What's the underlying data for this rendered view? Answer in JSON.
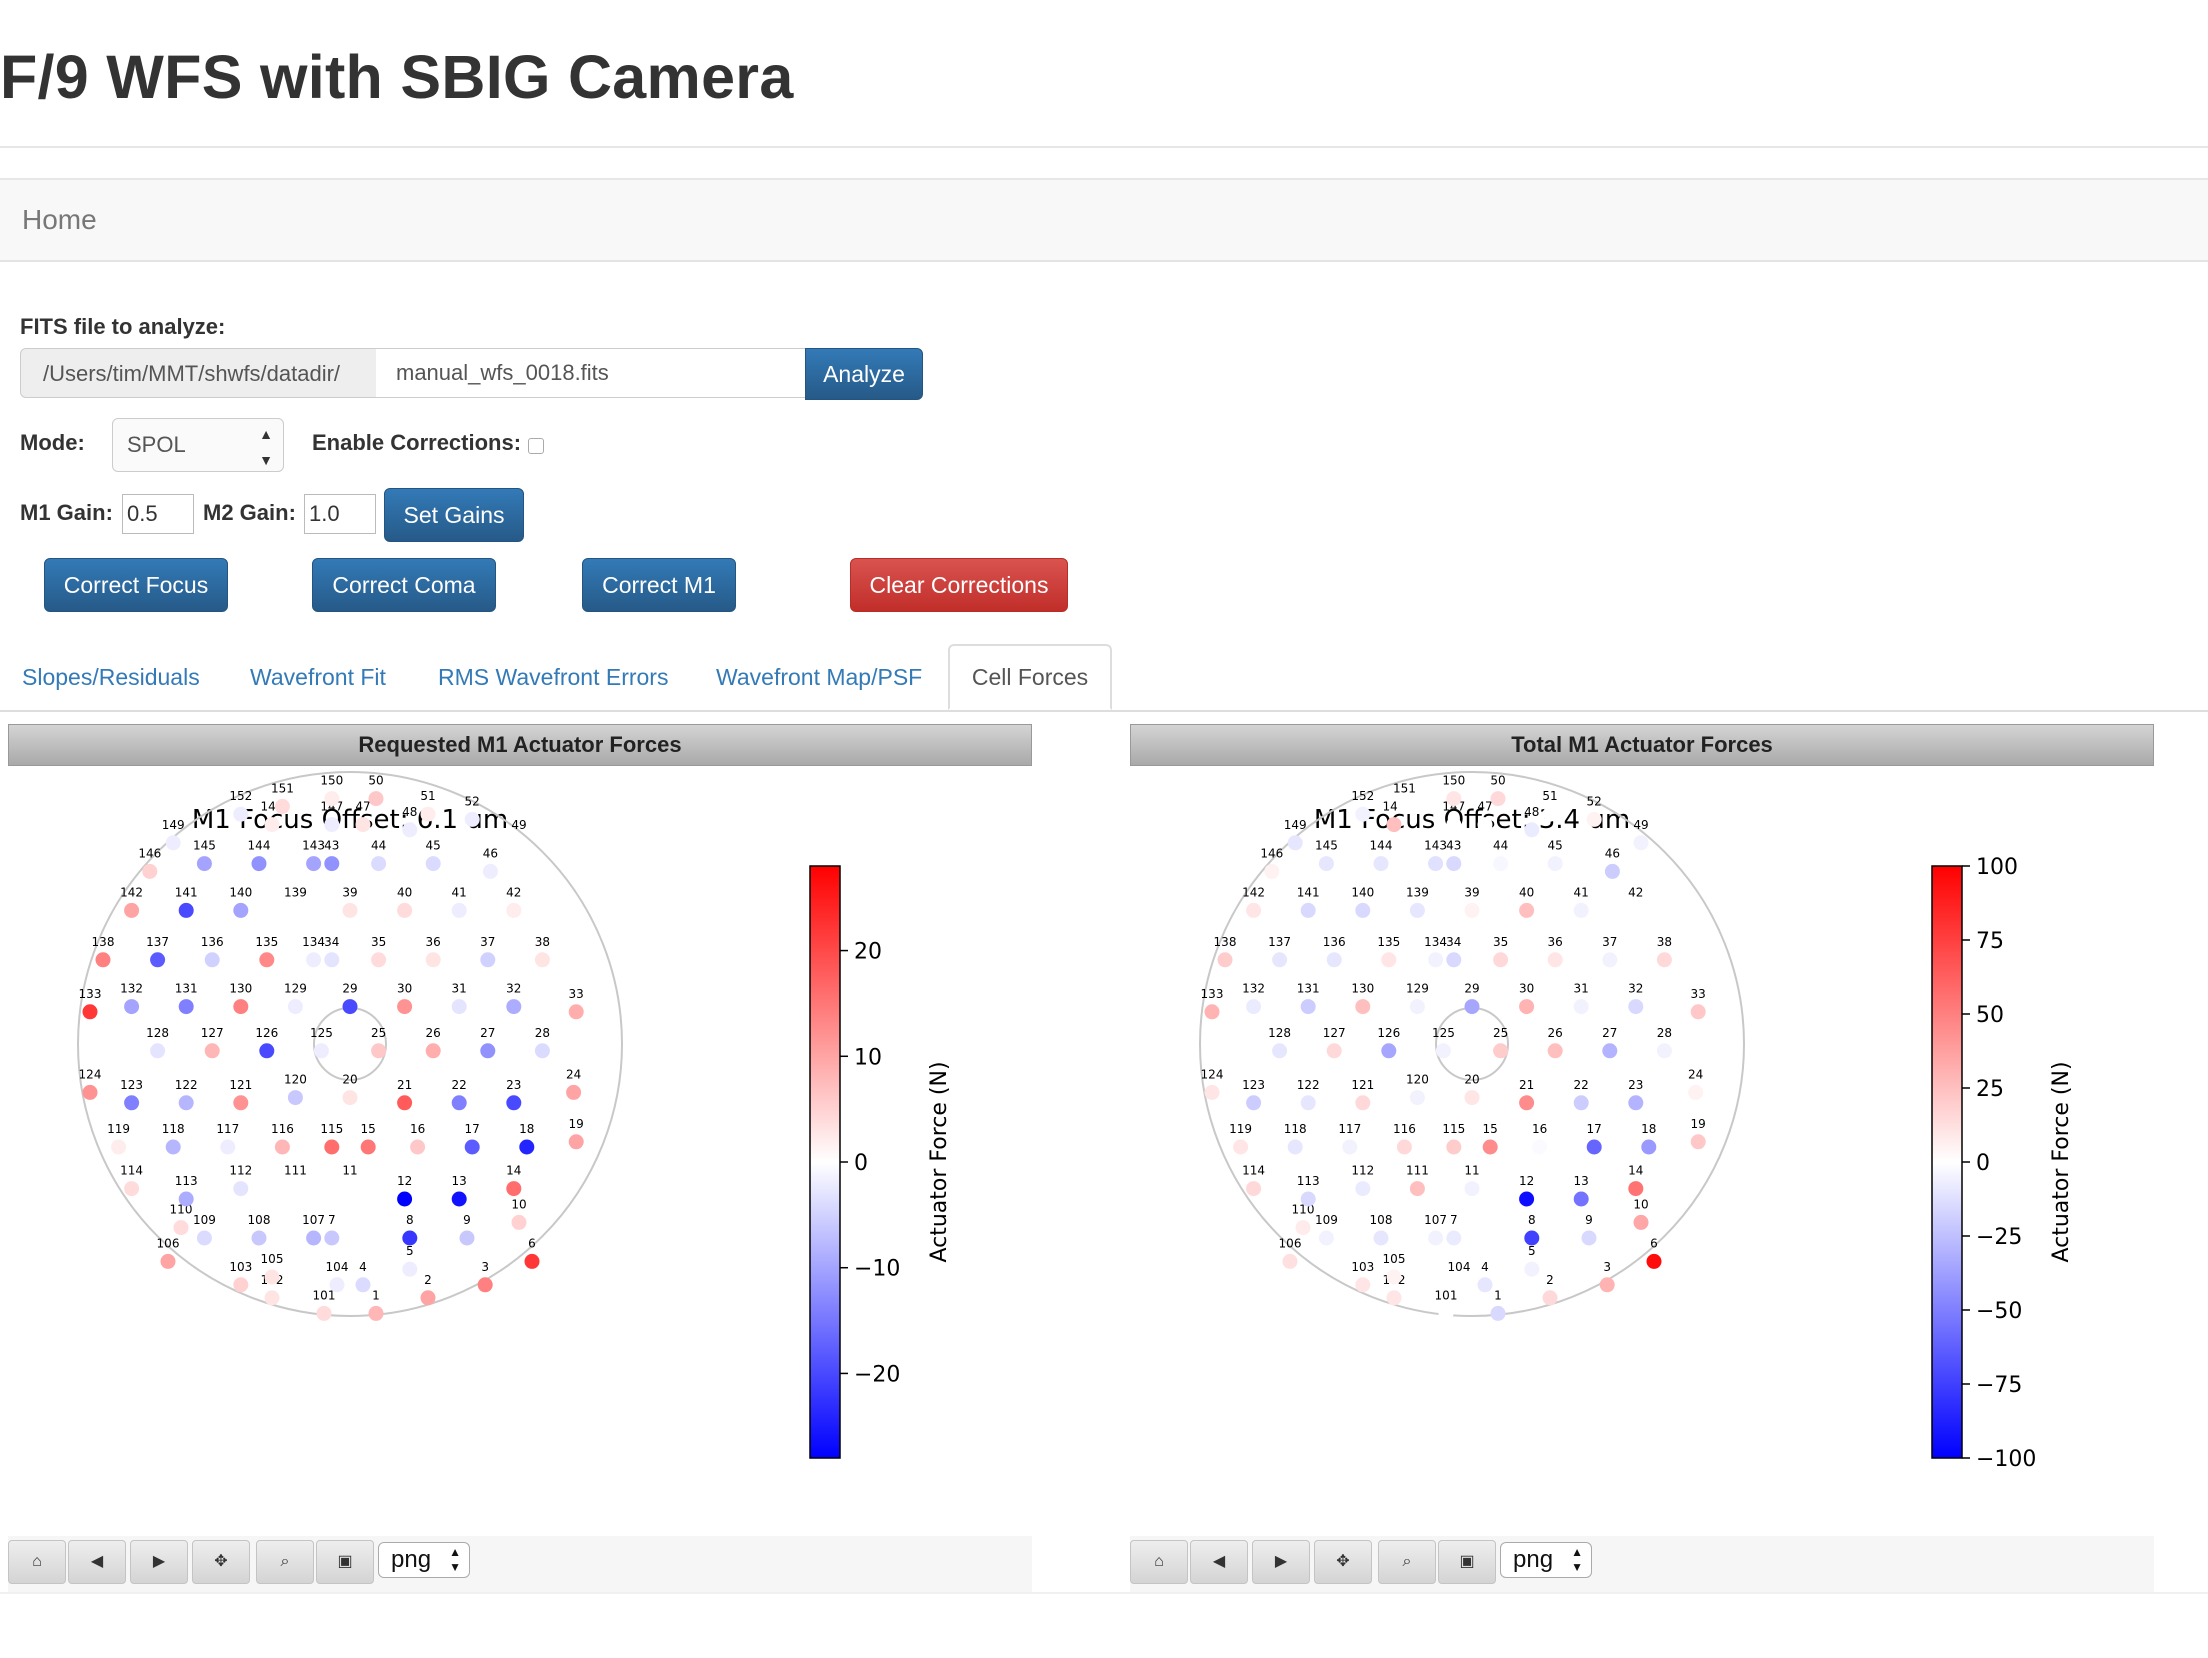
{
  "page": {
    "title": "F/9 WFS with SBIG Camera",
    "nav_home": "Home"
  },
  "form": {
    "fits_label": "FITS file to analyze:",
    "dir_prefix": "/Users/tim/MMT/shwfs/datadir/",
    "file_value": "manual_wfs_0018.fits",
    "analyze_label": "Analyze",
    "mode_label": "Mode:",
    "mode_value": "SPOL",
    "enable_corrections_label": "Enable Corrections:",
    "enable_corrections_checked": false,
    "m1_gain_label": "M1 Gain:",
    "m1_gain_value": "0.5",
    "m2_gain_label": "M2 Gain:",
    "m2_gain_value": "1.0",
    "set_gains_label": "Set Gains",
    "correct_focus_label": "Correct Focus",
    "correct_coma_label": "Correct Coma",
    "correct_m1_label": "Correct M1",
    "clear_corrections_label": "Clear Corrections"
  },
  "tabs": [
    {
      "label": "Slopes/Residuals"
    },
    {
      "label": "Wavefront Fit"
    },
    {
      "label": "RMS Wavefront Errors"
    },
    {
      "label": "Wavefront Map/PSF"
    },
    {
      "label": "Cell Forces",
      "active": true
    }
  ],
  "colors": {
    "primary_button": "#337ab7",
    "danger_button": "#d9534f",
    "link": "#337ab7",
    "colormap_low": "#0000ff",
    "colormap_mid": "#ffffff",
    "colormap_high": "#ff0000"
  },
  "toolbar": {
    "format_value": "png",
    "icons": [
      "home-icon",
      "back-icon",
      "forward-icon",
      "pan-icon",
      "zoom-icon",
      "save-icon"
    ]
  },
  "panels": [
    {
      "header": "Requested M1 Actuator Forces",
      "plot_title": "M1 Focus Offset: 6.1 um",
      "colorbar_label": "Actuator Force (N)",
      "colorbar_ticks": [
        "20",
        "10",
        "0",
        "−10",
        "−20"
      ]
    },
    {
      "header": "Total M1 Actuator Forces",
      "plot_title": "M1 Focus Offset: 3.4 um",
      "colorbar_label": "Actuator Force (N)",
      "colorbar_ticks": [
        "100",
        "75",
        "50",
        "25",
        "0",
        "−25",
        "−50",
        "−75",
        "−100"
      ]
    }
  ],
  "chart_data": [
    {
      "type": "scatter",
      "title": "M1 Focus Offset: 6.1 um",
      "colorbar_label": "Actuator Force (N)",
      "colorbar_range": [
        -28,
        28
      ],
      "actuator_labels": [
        "1",
        "2",
        "3",
        "4",
        "5",
        "6",
        "7",
        "8",
        "9",
        "10",
        "11",
        "12",
        "13",
        "14",
        "15",
        "16",
        "17",
        "18",
        "19",
        "20",
        "21",
        "22",
        "23",
        "24",
        "25",
        "26",
        "27",
        "28",
        "29",
        "30",
        "31",
        "32",
        "33",
        "34",
        "35",
        "36",
        "37",
        "38",
        "39",
        "40",
        "41",
        "42",
        "43",
        "44",
        "45",
        "46",
        "47",
        "48",
        "49",
        "50",
        "51",
        "52",
        "101",
        "102",
        "103",
        "104",
        "105",
        "106",
        "107",
        "108",
        "109",
        "110",
        "111",
        "112",
        "113",
        "114",
        "115",
        "116",
        "117",
        "118",
        "119",
        "120",
        "121",
        "122",
        "123",
        "124",
        "125",
        "126",
        "127",
        "128",
        "129",
        "130",
        "131",
        "132",
        "133",
        "134",
        "135",
        "136",
        "137",
        "138",
        "139",
        "140",
        "141",
        "142",
        "143",
        "144",
        "145",
        "146",
        "147",
        "148",
        "149",
        "150",
        "151",
        "152"
      ],
      "forces": [
        8,
        10,
        14,
        -4,
        -2,
        22,
        -6,
        -22,
        -6,
        5,
        0,
        -28,
        -26,
        16,
        15,
        6,
        -18,
        -24,
        10,
        3,
        18,
        -14,
        -20,
        10,
        6,
        9,
        -12,
        -4,
        -20,
        12,
        -3,
        -9,
        9,
        -3,
        4,
        3,
        -5,
        3,
        3,
        4,
        -2,
        2,
        -12,
        -4,
        -4,
        -2,
        3,
        -2,
        0,
        6,
        2,
        -2,
        4,
        3,
        5,
        -2,
        3,
        10,
        -8,
        -6,
        -4,
        4,
        0,
        -3,
        -9,
        4,
        16,
        8,
        -2,
        -8,
        2,
        -6,
        12,
        -8,
        -14,
        12,
        -2,
        -20,
        8,
        -3,
        -2,
        14,
        -14,
        -10,
        22,
        -2,
        13,
        -5,
        -18,
        14,
        0,
        -10,
        -20,
        10,
        -10,
        -12,
        -10,
        5,
        -2,
        2,
        -2,
        2,
        4,
        -2
      ],
      "xlabel": "",
      "ylabel": ""
    },
    {
      "type": "scatter",
      "title": "M1 Focus Offset: 3.4 um",
      "colorbar_label": "Actuator Force (N)",
      "colorbar_range": [
        -100,
        100
      ],
      "actuator_labels": [
        "1",
        "2",
        "3",
        "4",
        "5",
        "6",
        "7",
        "8",
        "9",
        "10",
        "11",
        "12",
        "13",
        "14",
        "15",
        "16",
        "17",
        "18",
        "19",
        "20",
        "21",
        "22",
        "23",
        "24",
        "25",
        "26",
        "27",
        "28",
        "29",
        "30",
        "31",
        "32",
        "33",
        "34",
        "35",
        "36",
        "37",
        "38",
        "39",
        "40",
        "41",
        "42",
        "43",
        "44",
        "45",
        "46",
        "47",
        "48",
        "49",
        "50",
        "51",
        "52",
        "101",
        "102",
        "103",
        "104",
        "105",
        "106",
        "107",
        "108",
        "109",
        "110",
        "111",
        "112",
        "113",
        "114",
        "115",
        "116",
        "117",
        "118",
        "119",
        "120",
        "121",
        "122",
        "123",
        "124",
        "125",
        "126",
        "127",
        "128",
        "129",
        "130",
        "131",
        "132",
        "133",
        "134",
        "135",
        "136",
        "137",
        "138",
        "139",
        "140",
        "141",
        "142",
        "143",
        "144",
        "145",
        "146",
        "147",
        "148",
        "149",
        "150",
        "151",
        "152"
      ],
      "forces": [
        -15,
        15,
        30,
        -10,
        -5,
        95,
        -8,
        -75,
        -15,
        35,
        -5,
        -95,
        -55,
        55,
        45,
        -2,
        -60,
        -40,
        22,
        10,
        45,
        -20,
        -30,
        5,
        20,
        25,
        -30,
        -5,
        -35,
        30,
        -5,
        -15,
        22,
        -15,
        15,
        10,
        -5,
        15,
        5,
        25,
        -5,
        0,
        -15,
        -3,
        -5,
        -20,
        0,
        -8,
        -5,
        15,
        0,
        5,
        0,
        10,
        10,
        0,
        5,
        12,
        -5,
        -10,
        -5,
        8,
        25,
        -8,
        -15,
        15,
        20,
        15,
        -5,
        -10,
        10,
        -5,
        15,
        -10,
        -20,
        10,
        -5,
        -35,
        15,
        -10,
        -5,
        25,
        -20,
        -8,
        30,
        -5,
        10,
        -10,
        -10,
        20,
        -10,
        -15,
        -15,
        10,
        -12,
        -10,
        -10,
        5,
        0,
        25,
        -10,
        10,
        0,
        -5
      ],
      "xlabel": "",
      "ylabel": ""
    }
  ]
}
